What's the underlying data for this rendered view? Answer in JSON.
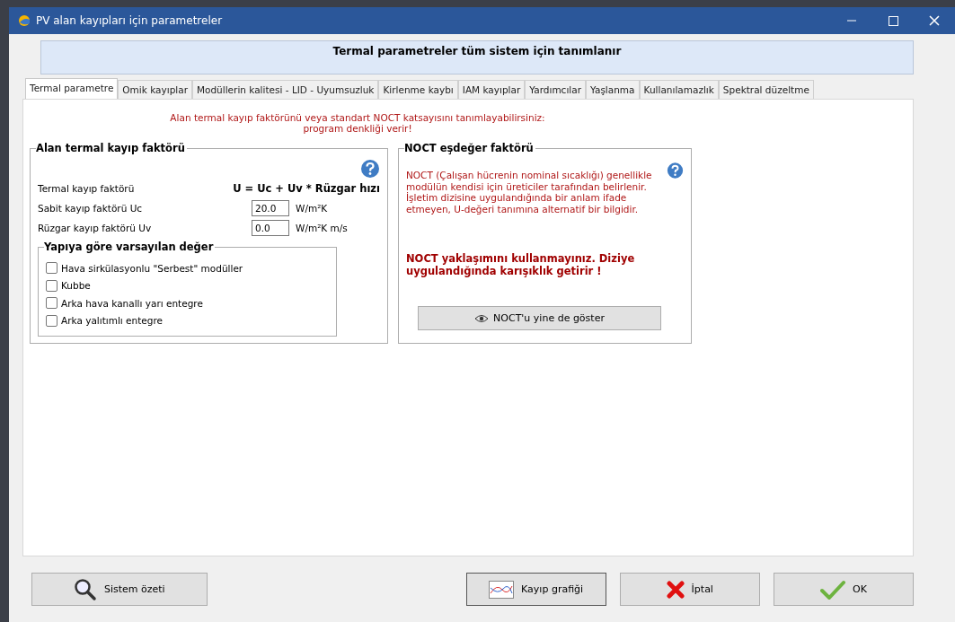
{
  "window": {
    "title": "PV alan kayıpları için parametreler"
  },
  "header": "Termal parametreler tüm sistem için tanımlanır",
  "tabs": [
    {
      "label": "Termal parametre",
      "selected": true
    },
    {
      "label": "Omik kayıplar",
      "selected": false
    },
    {
      "label": "Modüllerin kalitesi - LID - Uyumsuzluk",
      "selected": false
    },
    {
      "label": "Kirlenme kaybı",
      "selected": false
    },
    {
      "label": "IAM kayıplar",
      "selected": false
    },
    {
      "label": "Yardımcılar",
      "selected": false
    },
    {
      "label": "Yaşlanma",
      "selected": false
    },
    {
      "label": "Kullanılamazlık",
      "selected": false
    },
    {
      "label": "Spektral düzeltme",
      "selected": false
    }
  ],
  "intro": [
    "Alan termal kayıp faktörünü veya standart NOCT katsayısını tanımlayabilirsiniz:",
    "program denkliği verir!"
  ],
  "thermal_group": {
    "title": "Alan termal kayıp faktörü",
    "formula_label": "Termal kayıp faktörü",
    "formula": "U = Uc + Uv * Rüzgar hızı",
    "fields": [
      {
        "label": "Sabit kayıp faktörü Uc",
        "value": "20.0",
        "unit": "W/m²K"
      },
      {
        "label": "Rüzgar kayıp faktörü Uv",
        "value": "0.0",
        "unit": "W/m²K m/s"
      }
    ],
    "defaults": {
      "title": "Yapıya göre varsayılan değer",
      "options": [
        {
          "label": "Hava sirkülasyonlu \"Serbest\" modüller",
          "checked": false
        },
        {
          "label": "Kubbe",
          "checked": false
        },
        {
          "label": "Arka hava kanallı yarı entegre",
          "checked": false
        },
        {
          "label": "Arka yalıtımlı entegre",
          "checked": false
        }
      ]
    }
  },
  "noct_group": {
    "title": "NOCT eşdeğer faktörü",
    "description": "NOCT (Çalışan hücrenin nominal sıcaklığı) genellikle modülün kendisi için üreticiler tarafından belirlenir. İşletim dizisine uygulandığında bir anlam ifade etmeyen, U-değeri tanımına alternatif bir bilgidir.",
    "warning": "NOCT yaklaşımını kullanmayınız. Diziye uygulandığında karışıklık getirir !",
    "button": "NOCT'u yine de göster"
  },
  "buttons": [
    {
      "label": "Sistem özeti",
      "kind": "search"
    },
    {
      "label": "Kayıp grafiği",
      "kind": "chart"
    },
    {
      "label": "İptal",
      "kind": "cancel"
    },
    {
      "label": "OK",
      "kind": "ok"
    }
  ]
}
